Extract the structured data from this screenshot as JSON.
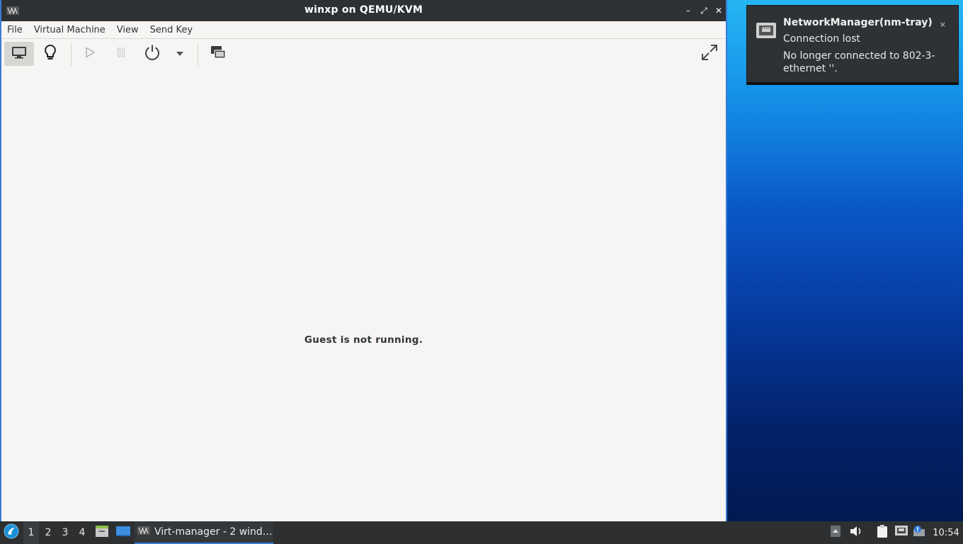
{
  "window": {
    "title": "winxp on QEMU/KVM",
    "controls": {
      "minimize": "–",
      "maximize": "⤢",
      "close": "✕"
    }
  },
  "menu": [
    "File",
    "Virtual Machine",
    "View",
    "Send Key"
  ],
  "toolbar": {
    "buttons": [
      "monitor-icon",
      "lightbulb-icon",
      "play-icon",
      "pause-icon",
      "power-icon",
      "dropdown-arrow-icon",
      "snapshots-icon",
      "fullscreen-icon"
    ]
  },
  "content": {
    "message": "Guest is not running."
  },
  "notification": {
    "app": "NetworkManager(nm-tray)",
    "summary": "Connection lost",
    "body": "No longer connected to 802-3-ethernet ''.",
    "close": "×"
  },
  "taskbar": {
    "workspaces": [
      "1",
      "2",
      "3",
      "4"
    ],
    "task_label": "Virt-manager - 2 wind…",
    "clock": "10:54"
  },
  "colors": {
    "accent": "#3a7bd5",
    "titlebar": "#2e3133",
    "taskbar": "#2d2f31"
  }
}
